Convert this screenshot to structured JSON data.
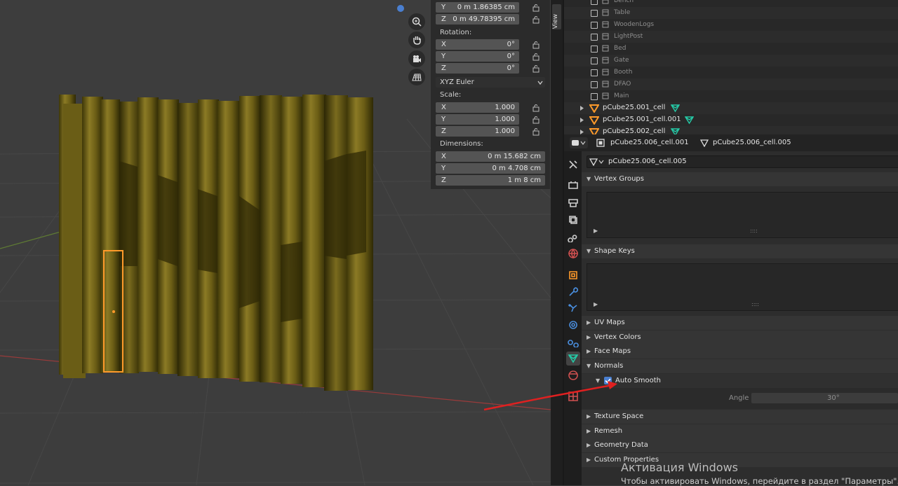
{
  "viewport": {
    "nav_icons": [
      "zoom-icon",
      "hand-pan-icon",
      "camera-icon",
      "ortho-grid-icon"
    ]
  },
  "npanel": {
    "loc_y_axis": "Y",
    "loc_y_value": "0 m 1.86385 cm",
    "loc_z_axis": "Z",
    "loc_z_value": "0 m 49.78395 cm",
    "rotation_label": "Rotation:",
    "rot_x_axis": "X",
    "rot_x_value": "0°",
    "rot_y_axis": "Y",
    "rot_y_value": "0°",
    "rot_z_axis": "Z",
    "rot_z_value": "0°",
    "rotation_mode": "XYZ Euler",
    "scale_label": "Scale:",
    "scale_x_axis": "X",
    "scale_x_value": "1.000",
    "scale_y_axis": "Y",
    "scale_y_value": "1.000",
    "scale_z_axis": "Z",
    "scale_z_value": "1.000",
    "dimensions_label": "Dimensions:",
    "dim_x_axis": "X",
    "dim_x_value": "0 m 15.682 cm",
    "dim_y_axis": "Y",
    "dim_y_value": "0 m 4.708 cm",
    "dim_z_axis": "Z",
    "dim_z_value": "1 m 8 cm",
    "view_tab": "View"
  },
  "outliner": {
    "collections": [
      "Bench",
      "Table",
      "WoodenLogs",
      "LightPost",
      "Bed",
      "Gate",
      "Booth",
      "DFAO",
      "Main"
    ],
    "meshes": [
      "pCube25.001_cell",
      "pCube25.001_cell.001",
      "pCube25.002_cell"
    ]
  },
  "properties": {
    "header_object": "pCube25.006_cell.001",
    "header_mesh": "pCube25.006_cell.005",
    "mesh_name": "pCube25.006_cell.005",
    "vertex_groups": "Vertex Groups",
    "shape_keys": "Shape Keys",
    "uv_maps": "UV Maps",
    "vertex_colors": "Vertex Colors",
    "face_maps": "Face Maps",
    "normals": "Normals",
    "auto_smooth": "Auto Smooth",
    "auto_smooth_checked": true,
    "angle_label": "Angle",
    "angle_value": "30°",
    "texture_space": "Texture Space",
    "remesh": "Remesh",
    "geometry_data": "Geometry Data",
    "custom_properties": "Custom Properties",
    "list_grip": "::::",
    "tri_open": "▼",
    "tri_closed": "▶"
  },
  "watermark": {
    "line1": "Активация Windows",
    "line2": "Чтобы активировать Windows, перейдите в раздел \"Параметры\"."
  },
  "colors": {
    "accent_blue": "#4a7fd0",
    "mesh_green": "#25c9a6",
    "wood": "#6d5f16",
    "selection": "#ff9a2a",
    "annotation_arrow": "#e02020"
  }
}
